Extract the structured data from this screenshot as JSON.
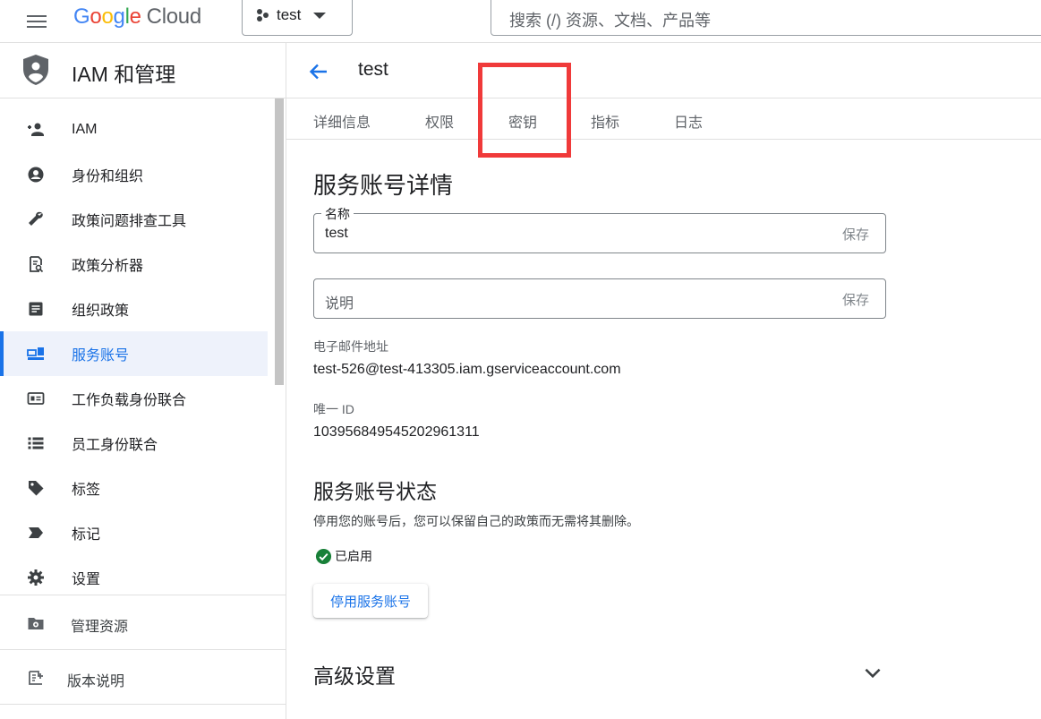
{
  "topbar": {
    "logo": {
      "g1": "G",
      "g2": "o",
      "g3": "o",
      "g4": "g",
      "g5": "l",
      "g6": "e",
      "cloud": "Cloud"
    },
    "project": "test",
    "search_placeholder": "搜索 (/) 资源、文档、产品等"
  },
  "sidebar": {
    "title": "IAM 和管理",
    "items": [
      {
        "label": "IAM",
        "icon": "person-add-icon"
      },
      {
        "label": "身份和组织",
        "icon": "account-circle-icon"
      },
      {
        "label": "政策问题排查工具",
        "icon": "wrench-icon"
      },
      {
        "label": "政策分析器",
        "icon": "document-search-icon"
      },
      {
        "label": "组织政策",
        "icon": "article-icon"
      },
      {
        "label": "服务账号",
        "icon": "service-account-icon",
        "active": true
      },
      {
        "label": "工作负载身份联合",
        "icon": "id-card-icon"
      },
      {
        "label": "员工身份联合",
        "icon": "list-icon"
      },
      {
        "label": "标签",
        "icon": "tag-icon"
      },
      {
        "label": "标记",
        "icon": "label-icon"
      },
      {
        "label": "设置",
        "icon": "gear-icon"
      }
    ],
    "manage_resources": "管理资源",
    "release_notes": "版本说明"
  },
  "main": {
    "title": "test",
    "tabs": [
      "详细信息",
      "权限",
      "密钥",
      "指标",
      "日志"
    ],
    "section_title": "服务账号详情",
    "name_field": {
      "label": "名称",
      "value": "test",
      "save": "保存"
    },
    "desc_field": {
      "placeholder": "说明",
      "save": "保存"
    },
    "email_label": "电子邮件地址",
    "email_value": "test-526@test-413305.iam.gserviceaccount.com",
    "uid_label": "唯一 ID",
    "uid_value": "103956849545202961311",
    "status_title": "服务账号状态",
    "status_desc": "停用您的账号后，您可以保留自己的政策而无需将其删除。",
    "status_value": "已启用",
    "disable_button": "停用服务账号",
    "advanced_title": "高级设置"
  },
  "colors": {
    "accent": "#1a73e8",
    "highlight": "#f03a3a",
    "enabled": "#188038"
  }
}
